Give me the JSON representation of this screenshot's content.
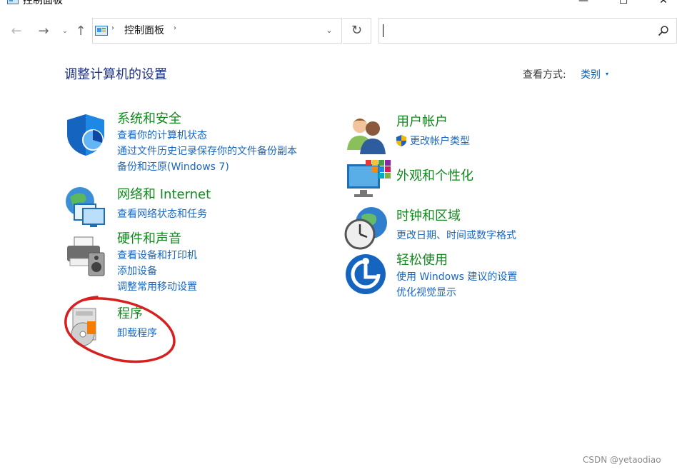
{
  "window": {
    "title": "控制面板",
    "minimize_glyph": "—",
    "maximize_glyph": "☐",
    "close_glyph": "✕"
  },
  "nav": {
    "back_glyph": "←",
    "forward_glyph": "→",
    "recent_glyph": "⌄",
    "up_glyph": "↑",
    "refresh_glyph": "↻"
  },
  "address": {
    "crumb": "控制面板",
    "separator": "›",
    "dropdown_glyph": "⌄"
  },
  "search": {
    "value": "",
    "placeholder": ""
  },
  "header": {
    "title": "调整计算机的设置",
    "view_label": "查看方式:",
    "view_value": "类别",
    "view_caret": "▾"
  },
  "categories": [
    {
      "title": "系统和安全",
      "icon": "shield-icon",
      "links": [
        "查看你的计算机状态",
        "通过文件历史记录保存你的文件备份副本",
        "备份和还原(Windows 7)"
      ]
    },
    {
      "title": "网络和 Internet",
      "icon": "network-globe-icon",
      "links": [
        "查看网络状态和任务"
      ]
    },
    {
      "title": "硬件和声音",
      "icon": "printer-speaker-icon",
      "links": [
        "查看设备和打印机",
        "添加设备",
        "调整常用移动设置"
      ]
    },
    {
      "title": "程序",
      "icon": "programs-disc-icon",
      "links": [
        "卸载程序"
      ]
    },
    {
      "title": "用户帐户",
      "icon": "users-icon",
      "links": [
        "更改帐户类型"
      ]
    },
    {
      "title": "外观和个性化",
      "icon": "monitor-colors-icon",
      "links": []
    },
    {
      "title": "时钟和区域",
      "icon": "clock-globe-icon",
      "links": [
        "更改日期、时间或数字格式"
      ]
    },
    {
      "title": "轻松使用",
      "icon": "ease-of-access-icon",
      "links": [
        "使用 Windows 建议的设置",
        "优化视觉显示"
      ]
    }
  ],
  "watermark": "CSDN @yetaodiao",
  "colors": {
    "title_blue": "#1e3287",
    "category_green": "#13881f",
    "link_blue": "#1a67c2",
    "annotation_red": "#d81f1f"
  }
}
